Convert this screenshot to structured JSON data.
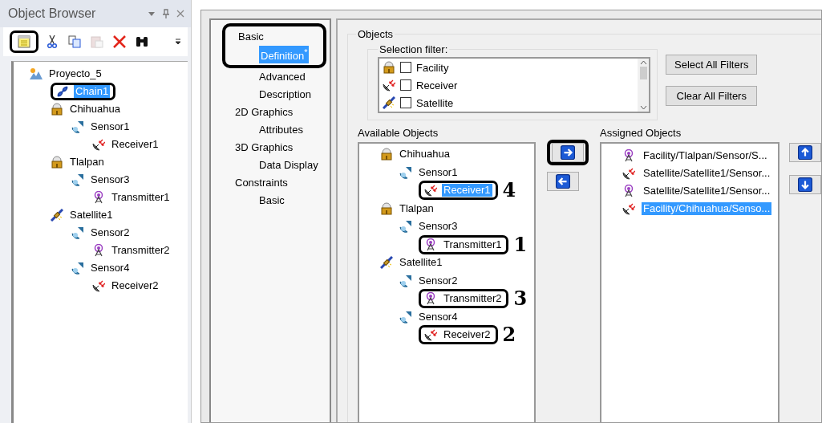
{
  "object_browser": {
    "title": "Object Browser",
    "toolbar": [
      {
        "kind": "new",
        "annotated": true,
        "disabled": false
      },
      {
        "kind": "cut",
        "annotated": false,
        "disabled": false
      },
      {
        "kind": "copy",
        "annotated": false,
        "disabled": false
      },
      {
        "kind": "paste",
        "annotated": false,
        "disabled": true
      },
      {
        "kind": "delete",
        "annotated": false,
        "disabled": false
      },
      {
        "kind": "find",
        "annotated": false,
        "disabled": false
      }
    ],
    "tree": [
      {
        "label": "Proyecto_5",
        "kind": "scenario",
        "selected": false,
        "annotated": false,
        "children": [
          {
            "label": "Chain1",
            "kind": "chain",
            "selected": true,
            "annotated": true
          },
          {
            "label": "Chihuahua",
            "kind": "facility",
            "selected": false,
            "annotated": false,
            "children": [
              {
                "label": "Sensor1",
                "kind": "sensor",
                "selected": false,
                "annotated": false,
                "children": [
                  {
                    "label": "Receiver1",
                    "kind": "receiver",
                    "selected": false,
                    "annotated": false
                  }
                ]
              }
            ]
          },
          {
            "label": "Tlalpan",
            "kind": "facility",
            "selected": false,
            "annotated": false,
            "children": [
              {
                "label": "Sensor3",
                "kind": "sensor",
                "selected": false,
                "annotated": false,
                "children": [
                  {
                    "label": "Transmitter1",
                    "kind": "transmitter",
                    "selected": false,
                    "annotated": false
                  }
                ]
              }
            ]
          },
          {
            "label": "Satellite1",
            "kind": "satellite",
            "selected": false,
            "annotated": false,
            "children": [
              {
                "label": "Sensor2",
                "kind": "sensor",
                "selected": false,
                "annotated": false,
                "children": [
                  {
                    "label": "Transmitter2",
                    "kind": "transmitter",
                    "selected": false,
                    "annotated": false
                  }
                ]
              },
              {
                "label": "Sensor4",
                "kind": "sensor",
                "selected": false,
                "annotated": false,
                "children": [
                  {
                    "label": "Receiver2",
                    "kind": "receiver",
                    "selected": false,
                    "annotated": false
                  }
                ]
              }
            ]
          }
        ]
      }
    ]
  },
  "properties": {
    "nav": [
      {
        "label": "Basic",
        "annotated": true,
        "children": [
          {
            "label": "Definition$^{*}$",
            "selected": true
          },
          {
            "label": "Advanced",
            "selected": false
          },
          {
            "label": "Description",
            "selected": false
          }
        ]
      },
      {
        "label": "2D Graphics",
        "annotated": false,
        "children": [
          {
            "label": "Attributes",
            "selected": false
          }
        ]
      },
      {
        "label": "3D Graphics",
        "annotated": false,
        "children": [
          {
            "label": "Data Display",
            "selected": false
          }
        ]
      },
      {
        "label": "Constraints",
        "annotated": false,
        "children": [
          {
            "label": "Basic",
            "selected": false
          }
        ]
      }
    ],
    "objects": {
      "title": "Objects",
      "filter": {
        "label": "Selection filter:",
        "items": [
          {
            "label": "Facility",
            "kind": "facility",
            "checked": false
          },
          {
            "label": "Receiver",
            "kind": "receiver",
            "checked": false
          },
          {
            "label": "Satellite",
            "kind": "satellite",
            "checked": false
          }
        ]
      },
      "filter_buttons": [
        "Select All Filters",
        "Clear All Filters"
      ],
      "available": {
        "label": "Available Objects",
        "tree": [
          {
            "label": "Chihuahua",
            "kind": "facility",
            "selected": false,
            "annotated": false,
            "children": [
              {
                "label": "Sensor1",
                "kind": "sensor",
                "selected": false,
                "annotated": false,
                "children": [
                  {
                    "label": "Receiver1",
                    "kind": "receiver",
                    "selected": true,
                    "annotated": true,
                    "callout": "4"
                  }
                ]
              }
            ]
          },
          {
            "label": "Tlalpan",
            "kind": "facility",
            "selected": false,
            "annotated": false,
            "children": [
              {
                "label": "Sensor3",
                "kind": "sensor",
                "selected": false,
                "annotated": false,
                "children": [
                  {
                    "label": "Transmitter1",
                    "kind": "transmitter",
                    "selected": false,
                    "annotated": true,
                    "callout": "1"
                  }
                ]
              }
            ]
          },
          {
            "label": "Satellite1",
            "kind": "satellite",
            "selected": false,
            "annotated": false,
            "children": [
              {
                "label": "Sensor2",
                "kind": "sensor",
                "selected": false,
                "annotated": false,
                "children": [
                  {
                    "label": "Transmitter2",
                    "kind": "transmitter",
                    "selected": false,
                    "annotated": true,
                    "callout": "3"
                  }
                ]
              },
              {
                "label": "Sensor4",
                "kind": "sensor",
                "selected": false,
                "annotated": false,
                "children": [
                  {
                    "label": "Receiver2",
                    "kind": "receiver",
                    "selected": false,
                    "annotated": true,
                    "callout": "2"
                  }
                ]
              }
            ]
          }
        ]
      },
      "move_buttons": [
        {
          "kind": "add",
          "annotated": true
        },
        {
          "kind": "remove",
          "annotated": false
        }
      ],
      "assigned": {
        "label": "Assigned Objects",
        "items": [
          {
            "label": "Facility/Tlalpan/Sensor/S...",
            "kind": "transmitter",
            "selected": false
          },
          {
            "label": "Satellite/Satellite1/Sensor...",
            "kind": "receiver",
            "selected": false
          },
          {
            "label": "Satellite/Satellite1/Sensor...",
            "kind": "transmitter",
            "selected": false
          },
          {
            "label": "Facility/Chihuahua/Senso...",
            "kind": "receiver",
            "selected": true
          }
        ]
      },
      "order_buttons": [
        {
          "kind": "up"
        },
        {
          "kind": "down"
        }
      ]
    }
  }
}
